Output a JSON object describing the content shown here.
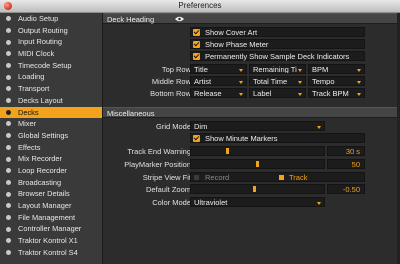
{
  "window": {
    "title": "Preferences"
  },
  "sidebar": {
    "items": [
      {
        "label": "Audio Setup"
      },
      {
        "label": "Output Routing"
      },
      {
        "label": "Input Routing"
      },
      {
        "label": "MIDI Clock"
      },
      {
        "label": "Timecode Setup"
      },
      {
        "label": "Loading"
      },
      {
        "label": "Transport"
      },
      {
        "label": "Decks Layout"
      },
      {
        "label": "Decks",
        "active": true
      },
      {
        "label": "Mixer"
      },
      {
        "label": "Global Settings"
      },
      {
        "label": "Effects"
      },
      {
        "label": "Mix Recorder"
      },
      {
        "label": "Loop Recorder"
      },
      {
        "label": "Broadcasting"
      },
      {
        "label": "Browser Details"
      },
      {
        "label": "Layout Manager"
      },
      {
        "label": "File Management"
      },
      {
        "label": "Controller Manager"
      },
      {
        "label": "Traktor Kontrol X1"
      },
      {
        "label": "Traktor Kontrol S4"
      }
    ]
  },
  "deck_heading": {
    "title": "Deck Heading",
    "icon": "eye-icon",
    "show_cover_art": "Show Cover Art",
    "show_phase_meter": "Show Phase Meter",
    "permanently_show": "Permanently Show Sample Deck Indicators",
    "top_row": {
      "label": "Top Row",
      "values": [
        "Title",
        "Remaining Ti",
        "BPM"
      ]
    },
    "middle_row": {
      "label": "Middle Row",
      "values": [
        "Artist",
        "Total Time",
        "Tempo"
      ]
    },
    "bottom_row": {
      "label": "Bottom Row",
      "values": [
        "Release",
        "Label",
        "Track BPM"
      ]
    }
  },
  "miscellaneous": {
    "title": "Miscellaneous",
    "grid_mode": {
      "label": "Grid Mode",
      "value": "Dim"
    },
    "show_minute_markers": "Show Minute Markers",
    "track_end_warning": {
      "label": "Track End Warning",
      "value": "30 s",
      "level": 0.27
    },
    "playmarker_position": {
      "label": "PlayMarker Position",
      "value": "50",
      "level": 0.5
    },
    "stripe_view_fit": {
      "label": "Stripe View Fit",
      "options": [
        "Record",
        "Track"
      ],
      "selected": "Track"
    },
    "default_zoom": {
      "label": "Default Zoom",
      "value": "-0.50",
      "level": 0.48
    },
    "color_mode": {
      "label": "Color Mode",
      "value": "Ultraviolet"
    }
  },
  "colors": {
    "accent": "#f3a21b",
    "panel": "#2c2c2c",
    "field": "#1c1c1c"
  }
}
